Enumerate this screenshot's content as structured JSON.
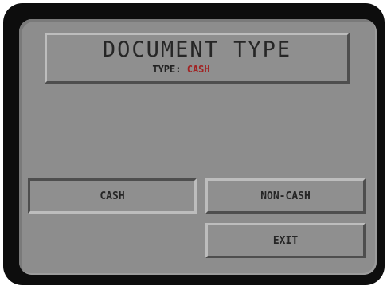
{
  "screen": {
    "title": "DOCUMENT TYPE",
    "type_label": "TYPE: ",
    "type_value": "CASH"
  },
  "buttons": {
    "cash": "CASH",
    "non_cash": "NON-CASH",
    "exit": "EXIT"
  },
  "colors": {
    "screen_background": "#8d8d8d",
    "bezel": "#0d0d0d",
    "selected_value_text": "#a12222"
  }
}
